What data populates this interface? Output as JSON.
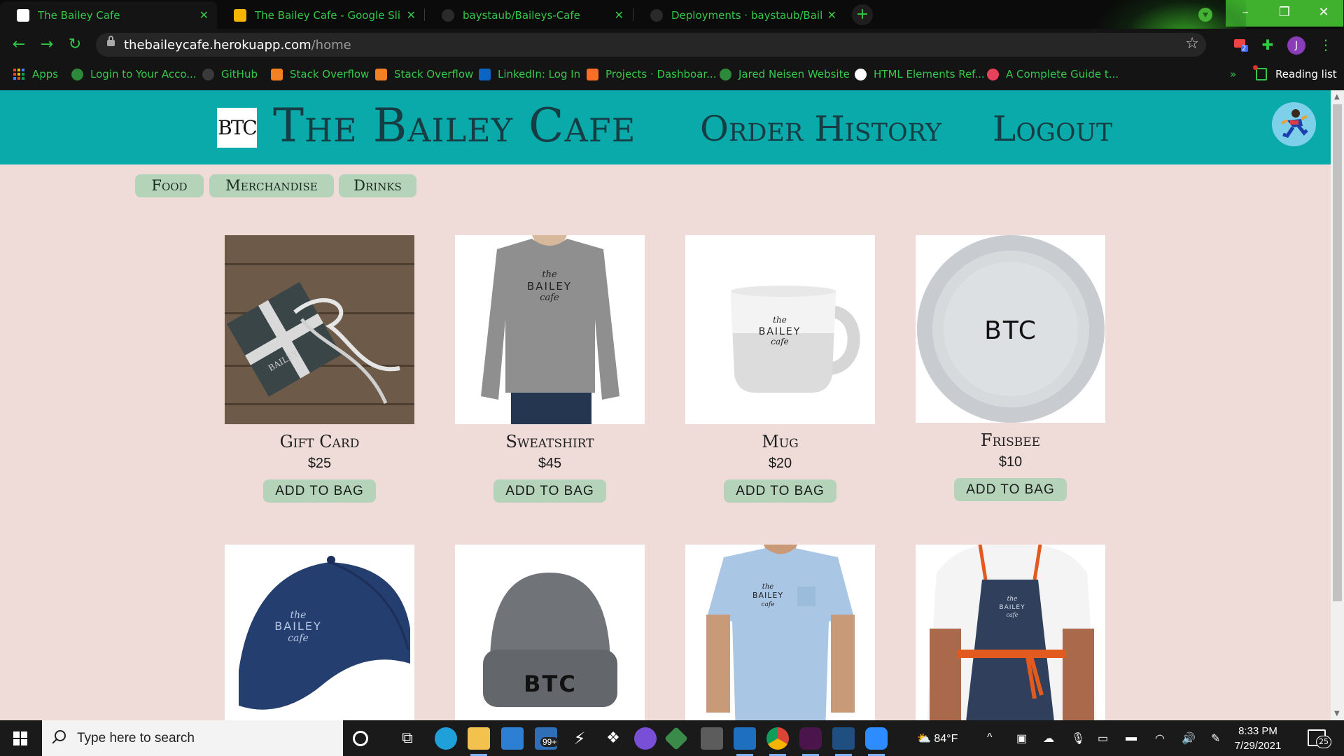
{
  "browser": {
    "tabs": [
      {
        "title": "The Bailey Cafe",
        "active": true
      },
      {
        "title": "The Bailey Cafe - Google Slides",
        "active": false
      },
      {
        "title": "baystaub/Baileys-Cafe",
        "active": false
      },
      {
        "title": "Deployments · baystaub/Baileys-",
        "active": false
      }
    ],
    "url_host": "thebaileycafe.herokuapp.com",
    "url_path": "/home",
    "extension_badge": "2",
    "profile_initial": "J",
    "bookmarks": [
      {
        "label": "Apps",
        "icon": "apps-grid-icon"
      },
      {
        "label": "Login to Your Acco...",
        "icon": "globe-icon"
      },
      {
        "label": "GitHub",
        "icon": "github-icon"
      },
      {
        "label": "Stack Overflow",
        "icon": "stackoverflow-icon"
      },
      {
        "label": "Stack Overflow",
        "icon": "stackoverflow-icon"
      },
      {
        "label": "LinkedIn: Log In",
        "icon": "linkedin-icon"
      },
      {
        "label": "Projects · Dashboar...",
        "icon": "gitlab-icon"
      },
      {
        "label": "Jared Neisen Website",
        "icon": "globe-icon"
      },
      {
        "label": "HTML Elements Ref...",
        "icon": "mdn-icon"
      },
      {
        "label": "A Complete Guide t...",
        "icon": "csstricks-icon"
      }
    ],
    "bookmarks_more": "»",
    "reading_list": "Reading list",
    "accent_color": "#34c84a"
  },
  "site": {
    "logo_text": "BTC",
    "brand": "The Bailey Cafe",
    "nav": {
      "order_history": "Order History",
      "logout": "Logout"
    },
    "header_color": "#0aaaaa",
    "background_color": "#efdcd9",
    "filters": [
      "Food",
      "Merchandise",
      "Drinks"
    ],
    "products": [
      {
        "name": "Gift Card",
        "price": "$25",
        "button": "ADD TO BAG",
        "image": "gift-card-image"
      },
      {
        "name": "Sweatshirt",
        "price": "$45",
        "button": "ADD TO BAG",
        "image": "sweatshirt-image"
      },
      {
        "name": "Mug",
        "price": "$20",
        "button": "ADD TO BAG",
        "image": "mug-image"
      },
      {
        "name": "Frisbee",
        "price": "$10",
        "button": "ADD TO BAG",
        "image": "frisbee-image"
      },
      {
        "name": "",
        "price": "",
        "button": "",
        "image": "cap-image"
      },
      {
        "name": "",
        "price": "",
        "button": "",
        "image": "beanie-image"
      },
      {
        "name": "",
        "price": "",
        "button": "",
        "image": "tshirt-image"
      },
      {
        "name": "",
        "price": "",
        "button": "",
        "image": "apron-image"
      }
    ],
    "print_text": {
      "the": "the",
      "bailey": "BAILEY",
      "cafe": "cafe",
      "btc": "BTC"
    }
  },
  "taskbar": {
    "search_placeholder": "Type here to search",
    "store_badge": "99+",
    "weather": "84°F",
    "time": "8:33 PM",
    "date": "7/29/2021",
    "notification_count": "25"
  }
}
